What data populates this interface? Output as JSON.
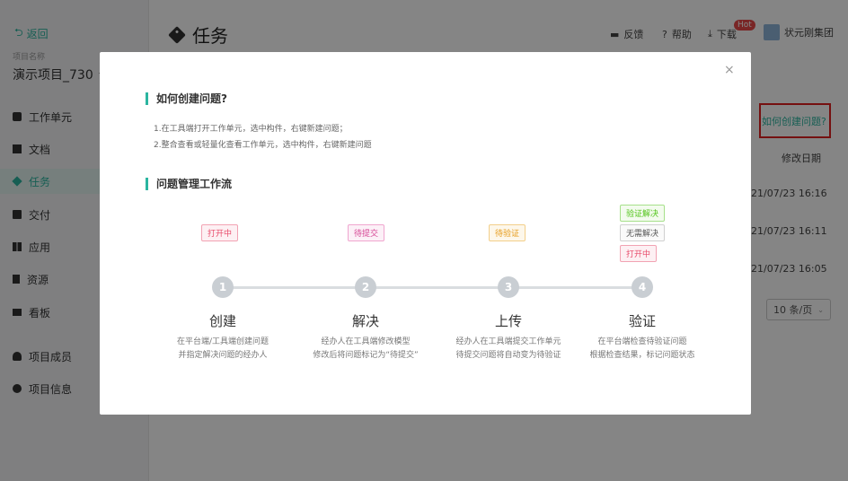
{
  "sidebar": {
    "back_label": "返回",
    "project_label": "项目名称",
    "project_name": "演示项目_730",
    "items": [
      {
        "label": "工作单元"
      },
      {
        "label": "文档"
      },
      {
        "label": "任务"
      },
      {
        "label": "交付"
      },
      {
        "label": "应用"
      },
      {
        "label": "资源"
      },
      {
        "label": "看板"
      },
      {
        "label": "项目成员"
      },
      {
        "label": "项目信息"
      }
    ]
  },
  "header": {
    "title": "任务",
    "feedback": "反馈",
    "help": "帮助",
    "download": "下载",
    "hot_badge": "Hot",
    "user": "状元刚集团"
  },
  "main": {
    "how_to_link": "如何创建问题?",
    "column_header": "修改日期",
    "dates": [
      "21/07/23 16:16",
      "21/07/23 16:11",
      "21/07/23 16:05"
    ],
    "page_size": "10 条/页"
  },
  "modal": {
    "close": "×",
    "section1_title": "如何创建问题?",
    "desc1": "1.在工具端打开工作单元，选中构件，右键新建问题；",
    "desc2": "2.整合查看或轻量化查看工作单元，选中构件，右键新建问题",
    "section2_title": "问题管理工作流",
    "statuses": {
      "open": "打开中",
      "pending_submit": "待提交",
      "pending_verify": "待验证",
      "verify_solved": "验证解决",
      "no_need_solve": "无需解决",
      "open2": "打开中"
    },
    "steps": [
      {
        "num": "1",
        "name": "创建",
        "desc1": "在平台端/工具端创建问题",
        "desc2": "并指定解决问题的经办人"
      },
      {
        "num": "2",
        "name": "解决",
        "desc1": "经办人在工具端修改模型",
        "desc2": "修改后将问题标记为“待提交”"
      },
      {
        "num": "3",
        "name": "上传",
        "desc1": "经办人在工具端提交工作单元",
        "desc2": "待提交问题将自动变为待验证"
      },
      {
        "num": "4",
        "name": "验证",
        "desc1": "在平台端检查待验证问题",
        "desc2": "根据检查结果，标记问题状态"
      }
    ]
  }
}
